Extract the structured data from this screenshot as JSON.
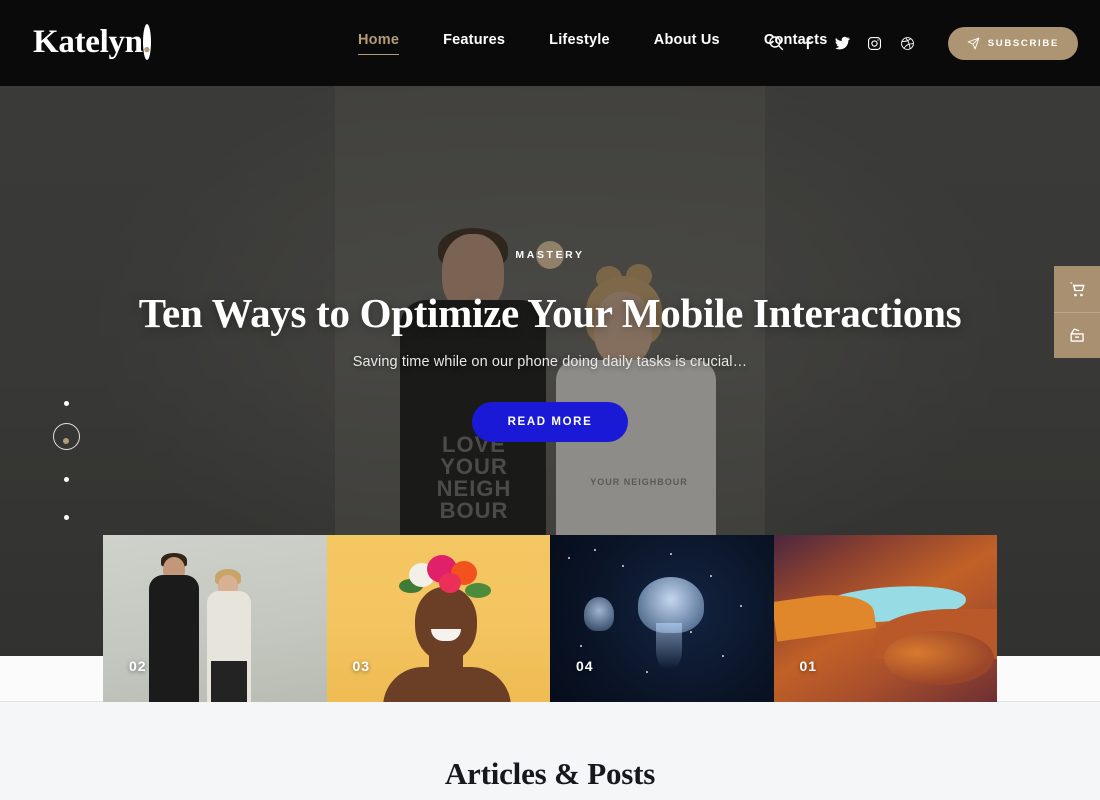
{
  "colors": {
    "header_bg": "#0a0a0a",
    "accent_tan": "#b39a78",
    "subscribe_bg": "#ad9473",
    "read_more_bg": "#1a1ad6",
    "page_bg": "#f5f6f8",
    "hero_bg": "#4b4b49",
    "side_panel_bg": "#a89070"
  },
  "header": {
    "logo_text": "Katelyn",
    "logo_dot": ".",
    "nav": [
      {
        "label": "Home",
        "active": true
      },
      {
        "label": "Features",
        "active": false
      },
      {
        "label": "Lifestyle",
        "active": false
      },
      {
        "label": "About Us",
        "active": false
      },
      {
        "label": "Contacts",
        "active": false
      }
    ],
    "icons": [
      {
        "name": "search-icon"
      },
      {
        "name": "facebook-icon"
      },
      {
        "name": "twitter-icon"
      },
      {
        "name": "instagram-icon"
      },
      {
        "name": "dribbble-icon"
      }
    ],
    "subscribe_label": "SUBSCRIBE",
    "subscribe_icon": "paper-plane-icon"
  },
  "hero": {
    "badge": "MASTERY",
    "title": "Ten Ways to Optimize Your Mobile Interactions",
    "subtitle": "Saving time while on our phone doing daily tasks is crucial…",
    "button_label": "READ MORE",
    "slider_dots": [
      {
        "index": 1,
        "active": false
      },
      {
        "index": 2,
        "active": true
      },
      {
        "index": 3,
        "active": false
      },
      {
        "index": 4,
        "active": false
      }
    ]
  },
  "side_panels": [
    {
      "name": "cart-button",
      "icon": "shopping-cart-icon"
    },
    {
      "name": "package-button",
      "icon": "open-box-icon"
    }
  ],
  "thumbnails": [
    {
      "number": "02",
      "subject": "couple-in-front-of-gray-wall"
    },
    {
      "number": "03",
      "subject": "woman-with-flower-crown-yellow"
    },
    {
      "number": "04",
      "subject": "jellyfish-dark-water"
    },
    {
      "number": "01",
      "subject": "slot-canyon-with-sky"
    }
  ],
  "articles": {
    "heading": "Articles & Posts"
  }
}
